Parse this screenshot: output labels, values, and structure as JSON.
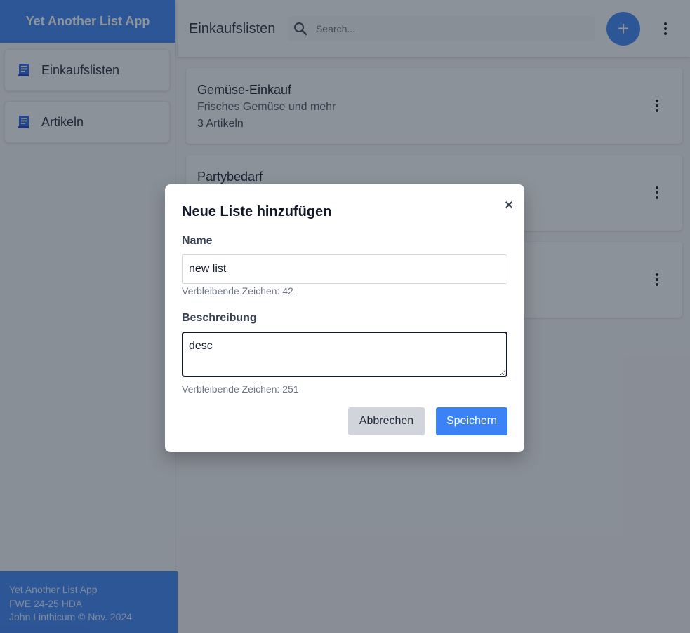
{
  "app": {
    "title": "Yet Another List App"
  },
  "sidebar": {
    "items": [
      {
        "label": "Einkaufslisten",
        "icon": "list-book-icon"
      },
      {
        "label": "Artikeln",
        "icon": "list-book-icon"
      }
    ],
    "footer": {
      "line1": "Yet Another List App",
      "line2": "FWE 24-25 HDA",
      "line3": "John Linthicum © Nov. 2024"
    }
  },
  "header": {
    "title": "Einkaufslisten",
    "search_placeholder": "Search...",
    "add_label": "+"
  },
  "lists": [
    {
      "title": "Gemüse-Einkauf",
      "description": "Frisches Gemüse und mehr",
      "count": "3 Artikeln"
    },
    {
      "title": "Partybedarf",
      "description": "",
      "count": ""
    },
    {
      "title": "",
      "description": "",
      "count": ""
    }
  ],
  "modal": {
    "title": "Neue Liste hinzufügen",
    "close_label": "×",
    "name_label": "Name",
    "name_value": "new list",
    "name_hint": "Verbleibende Zeichen: 42",
    "desc_label": "Beschreibung",
    "desc_value": "desc",
    "desc_hint": "Verbleibende Zeichen: 251",
    "cancel_label": "Abbrechen",
    "save_label": "Speichern"
  },
  "colors": {
    "primary": "#3b82f6",
    "overlay": "rgba(31,41,55,0.5)"
  }
}
